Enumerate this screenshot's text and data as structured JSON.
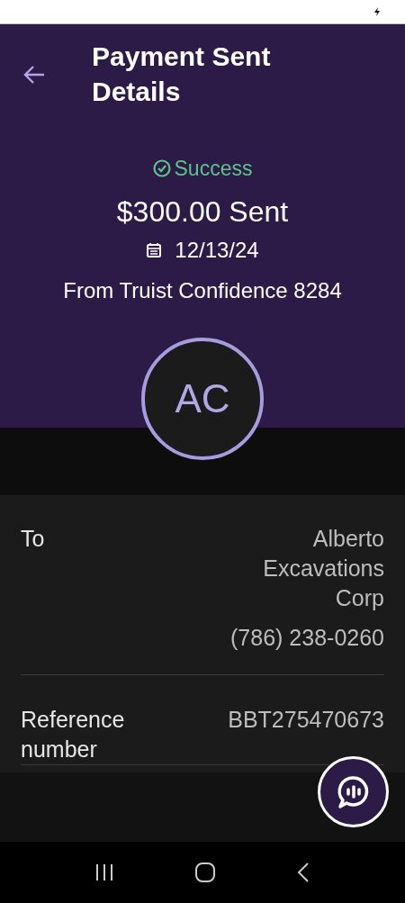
{
  "header": {
    "title": "Payment Sent Details"
  },
  "summary": {
    "status": "Success",
    "amount": "$300.00 Sent",
    "date": "12/13/24",
    "from_account": "From Truist Confidence 8284"
  },
  "avatar": {
    "initials": "AC"
  },
  "details": [
    {
      "label": "To",
      "values": [
        "Alberto Excavations Corp",
        "(786) 238-0260"
      ]
    },
    {
      "label": "Reference number",
      "values": [
        "BBT275470673"
      ]
    }
  ]
}
